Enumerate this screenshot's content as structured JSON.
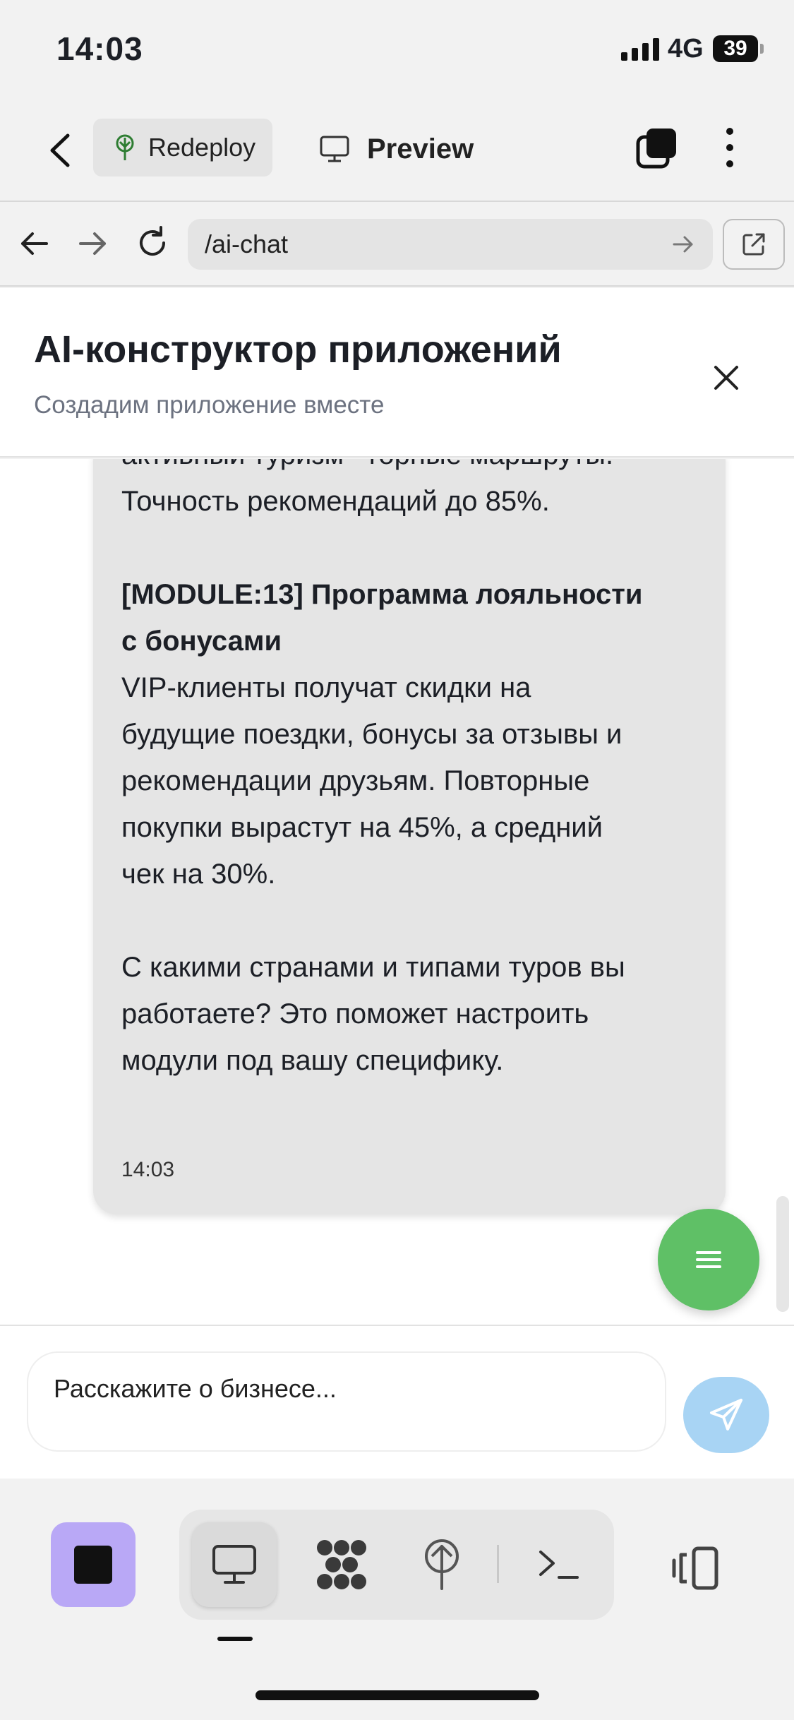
{
  "status": {
    "time": "14:03",
    "network": "4G",
    "battery": "39"
  },
  "app_bar": {
    "redeploy_label": "Redeploy",
    "preview_label": "Preview"
  },
  "browser": {
    "url": "/ai-chat"
  },
  "chat": {
    "title": "AI-конструктор приложений",
    "subtitle": "Создадим приложение вместе",
    "message": {
      "lines": [
        "активный туризм - горные маршруты.",
        "Точность рекомендаций до 85%.",
        "[MODULE:13] Программа лояльности",
        "с бонусами",
        "VIP-клиенты получат скидки на",
        "будущие поездки, бонусы за отзывы и",
        "рекомендации друзьям. Повторные",
        "покупки вырастут на 45%, а средний",
        "чек на 30%.",
        "С какими странами и типами туров вы",
        "работаете? Это поможет настроить",
        "модули под вашу специфику."
      ],
      "time": "14:03"
    },
    "input_placeholder": "Расскажите о бизнесе..."
  },
  "colors": {
    "fab": "#5fc066",
    "send": "#a8d4f4",
    "stop": "#b9a8f6",
    "bubble": "#e5e5e5"
  },
  "icons": [
    "back-chevron-icon",
    "tree-icon",
    "monitor-icon",
    "windows-icon",
    "more-vertical-icon",
    "arrow-left-icon",
    "arrow-right-icon",
    "reload-icon",
    "external-link-icon",
    "close-icon",
    "menu-icon",
    "send-icon",
    "stop-icon",
    "apps-icon",
    "deploy-icon",
    "terminal-icon",
    "layout-icon"
  ]
}
